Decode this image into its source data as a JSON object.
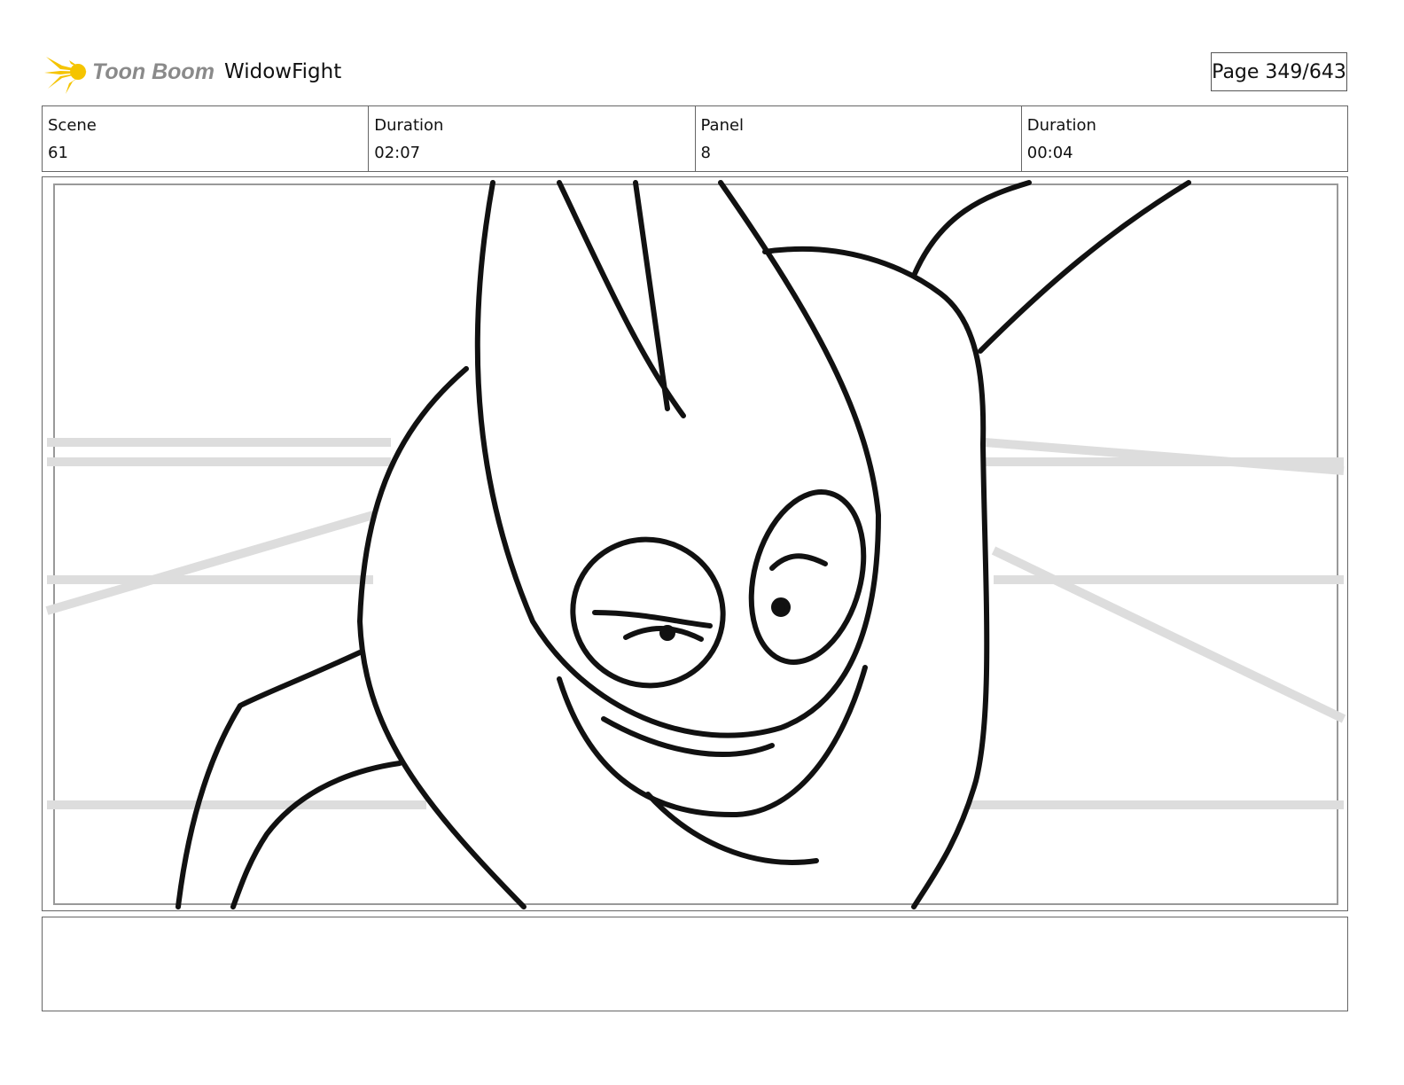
{
  "header": {
    "logo_text": "Toon Boom",
    "project_title": "WidowFight",
    "page_label": "Page 349/643"
  },
  "info": [
    {
      "label": "Scene",
      "value": "61"
    },
    {
      "label": "Duration",
      "value": "02:07"
    },
    {
      "label": "Panel",
      "value": "8"
    },
    {
      "label": "Duration",
      "value": "00:04"
    }
  ],
  "notes": {
    "text": ""
  }
}
